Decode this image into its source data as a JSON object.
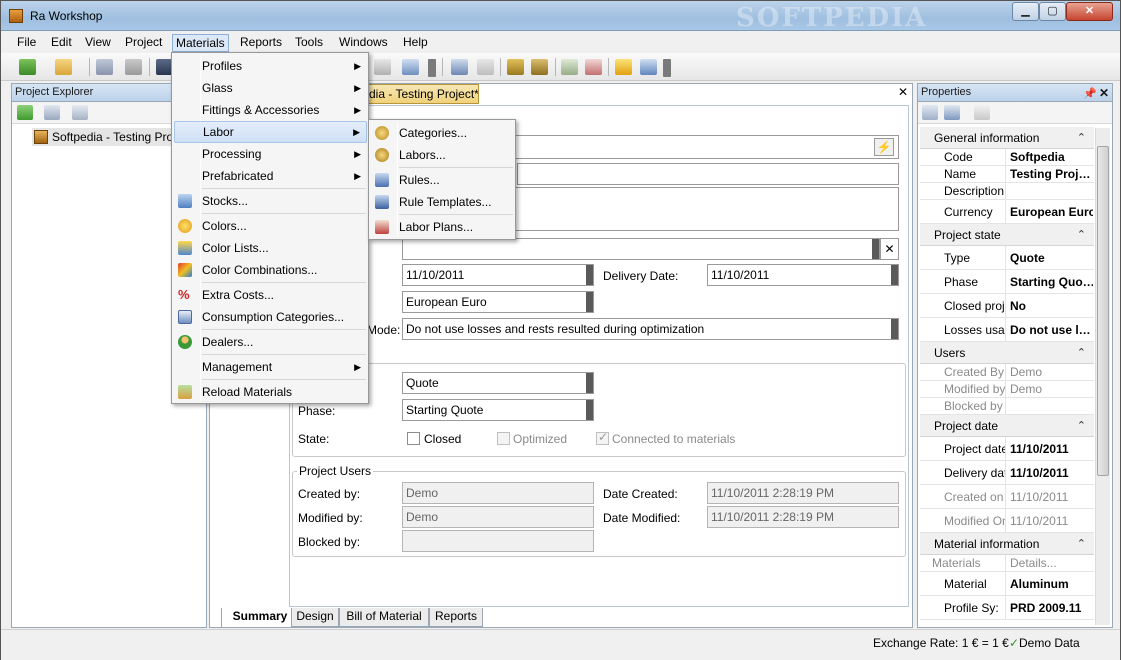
{
  "window": {
    "title": "Ra Workshop",
    "watermark": "SOFTPEDIA",
    "btn_min": "▁",
    "btn_max": "▢",
    "btn_close": "✕"
  },
  "menubar": [
    "File",
    "Edit",
    "View",
    "Project",
    "Materials",
    "Reports",
    "Tools",
    "Windows",
    "Help"
  ],
  "explorer": {
    "title": "Project Explorer",
    "node": "Softpedia - Testing Proje"
  },
  "document": {
    "tab": "dia - Testing Project*",
    "close": "✕",
    "start_date": "11/10/2011",
    "delivery_label": "Delivery Date:",
    "delivery_date": "11/10/2011",
    "currency": "European Euro",
    "mode_label": "Mode:",
    "mode_value": "Do not use losses and rests resulted during optimization",
    "type_value": "Quote",
    "phase_label": "Phase:",
    "phase_value": "Starting Quote",
    "state_label": "State:",
    "closed": "Closed",
    "optimized": "Optimized",
    "connected": "Connected to materials",
    "users_group": "Project Users",
    "created_by_label": "Created by:",
    "created_by": "Demo",
    "date_created_label": "Date Created:",
    "date_created": "11/10/2011 2:28:19 PM",
    "modified_by_label": "Modified by:",
    "modified_by": "Demo",
    "date_modified_label": "Date Modified:",
    "date_modified": "11/10/2011 2:28:19 PM",
    "blocked_by_label": "Blocked by:"
  },
  "summary_tabs": [
    "Summary",
    "Design",
    "Bill of Material",
    "Reports"
  ],
  "properties": {
    "title": "Properties",
    "pin": "📌",
    "close": "✕",
    "general": {
      "title": "General information",
      "rows": [
        [
          "Code",
          "Softpedia"
        ],
        [
          "Name",
          "Testing Proj…"
        ],
        [
          "Description",
          ""
        ],
        [
          "Currency",
          "European Euro"
        ]
      ]
    },
    "state": {
      "title": "Project state",
      "rows": [
        [
          "Type",
          "Quote"
        ],
        [
          "Phase",
          "Starting Quo…"
        ],
        [
          "Closed proje",
          "No"
        ],
        [
          "Losses usag",
          "Do not use l…"
        ]
      ]
    },
    "users": {
      "title": "Users",
      "rows": [
        [
          "Created By",
          "Demo"
        ],
        [
          "Modified by",
          "Demo"
        ],
        [
          "Blocked by",
          ""
        ]
      ]
    },
    "date": {
      "title": "Project date",
      "rows": [
        [
          "Project date",
          "11/10/2011"
        ],
        [
          "Delivery dat",
          "11/10/2011"
        ],
        [
          "Created on",
          "11/10/2011"
        ],
        [
          "Modified On",
          "11/10/2011"
        ]
      ]
    },
    "material": {
      "title": "Material information",
      "sub_key": "Materials",
      "sub_val": "Details...",
      "rows": [
        [
          "Material",
          "Aluminum"
        ],
        [
          "Profile Sy:",
          "PRD 2009.11"
        ]
      ]
    }
  },
  "statusbar": {
    "exchange": "Exchange Rate: 1 € = 1 €",
    "demo_icon": "✓",
    "demo": "Demo Data"
  },
  "materials_menu": [
    {
      "label": "Profiles",
      "sub": true
    },
    {
      "label": "Glass",
      "sub": true
    },
    {
      "label": "Fittings & Accessories",
      "sub": true
    },
    {
      "label": "Labor",
      "sub": true
    },
    {
      "label": "Processing",
      "sub": true
    },
    {
      "label": "Prefabricated",
      "sub": true
    },
    {
      "label": "Stocks..."
    },
    {
      "label": "Colors..."
    },
    {
      "label": "Color Lists..."
    },
    {
      "label": "Color Combinations..."
    },
    {
      "label": "Extra Costs..."
    },
    {
      "label": "Consumption Categories..."
    },
    {
      "label": "Dealers..."
    },
    {
      "label": "Management",
      "sub": true
    },
    {
      "label": "Reload Materials"
    }
  ],
  "labor_menu": [
    "Categories...",
    "Labors...",
    "Rules...",
    "Rule Templates...",
    "Labor Plans..."
  ],
  "arrow": "▶",
  "collapse": "⌃"
}
